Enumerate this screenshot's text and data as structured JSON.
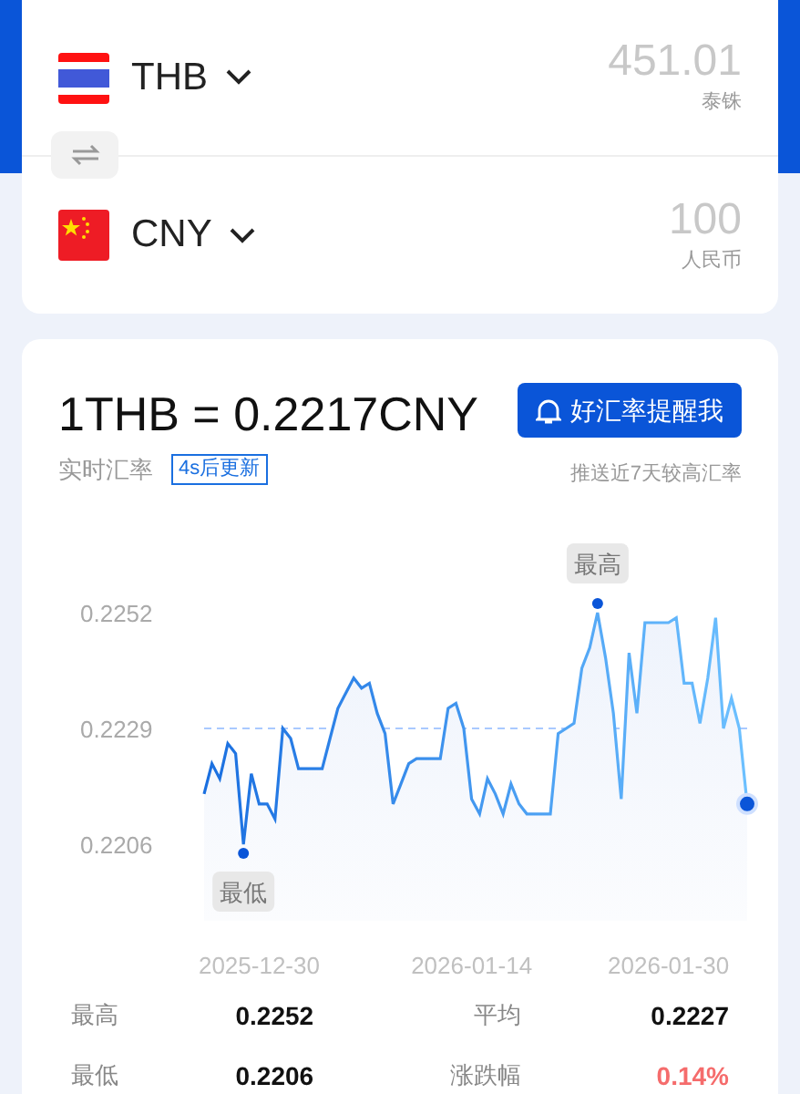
{
  "converter": [
    {
      "code": "THB",
      "kind": "thailand",
      "amount": "451.01",
      "name": "泰铢"
    },
    {
      "code": "CNY",
      "kind": "china",
      "amount": "100",
      "name": "人民币"
    }
  ],
  "rate": {
    "text": "1THB = 0.2217CNY",
    "label": "实时汇率",
    "refresh": "4s后更新",
    "alert_button": "好汇率提醒我",
    "alert_note": "推送近7天较高汇率"
  },
  "chart": {
    "chart_data": {
      "type": "area",
      "ylim": [
        0.2206,
        0.2252
      ],
      "yticks": [
        0.2206,
        0.2229,
        0.2252
      ],
      "categories": [
        null,
        null,
        null,
        null,
        null,
        null,
        null,
        "2025-12-30",
        null,
        null,
        null,
        null,
        null,
        null,
        null,
        null,
        null,
        null,
        null,
        null,
        null,
        null,
        null,
        null,
        null,
        null,
        null,
        null,
        null,
        null,
        null,
        null,
        null,
        null,
        "2026-01-14",
        null,
        null,
        null,
        null,
        null,
        null,
        null,
        null,
        null,
        null,
        null,
        null,
        null,
        null,
        null,
        null,
        null,
        null,
        null,
        null,
        null,
        null,
        null,
        null,
        "2026-01-30",
        null,
        null,
        null,
        null,
        null,
        null,
        null,
        null,
        null,
        null
      ],
      "series": [
        {
          "color": "#1a6fe0",
          "values": [
            0.2216,
            0.2222,
            0.2219,
            0.2226,
            0.2224,
            0.2206,
            0.222,
            0.2214,
            0.2214,
            0.2211,
            0.2229,
            0.2227,
            0.2221,
            0.2221,
            0.2221,
            0.2221,
            0.2227,
            0.2233,
            0.2236,
            0.2239,
            0.2237,
            0.2238,
            0.2232,
            0.2228,
            0.2214,
            0.2218,
            0.2222,
            0.2223,
            0.2223,
            0.2223,
            0.2223,
            0.2233,
            0.2234,
            0.2229,
            0.2215,
            0.2212,
            0.2219,
            0.2216,
            0.2212,
            0.2218,
            0.2214,
            0.2212,
            0.2212,
            0.2212,
            0.2212,
            0.2228,
            0.2229,
            0.223,
            0.2241,
            0.2245,
            0.2252,
            0.2243,
            0.2232,
            0.2215,
            0.2244,
            0.2232,
            0.225,
            0.225,
            0.225,
            0.225,
            0.2251,
            0.2238,
            0.2238,
            0.223,
            0.2239,
            0.2251,
            0.2229,
            0.2235,
            0.2229,
            0.2214
          ]
        }
      ],
      "ref_lines": [
        {
          "axis": "y",
          "value": 0.2229
        }
      ],
      "annotations": [
        {
          "text": "最高",
          "y": 0.2252
        },
        {
          "text": "最低",
          "y": 0.2206
        }
      ]
    }
  },
  "stats": [
    {
      "label": "最高",
      "value": "0.2252",
      "kind": "plain"
    },
    {
      "label": "平均",
      "value": "0.2227",
      "kind": "plain"
    },
    {
      "label": "最低",
      "value": "0.2206",
      "kind": "plain"
    },
    {
      "label": "涨跌幅",
      "value": "0.14%",
      "kind": "up"
    }
  ]
}
